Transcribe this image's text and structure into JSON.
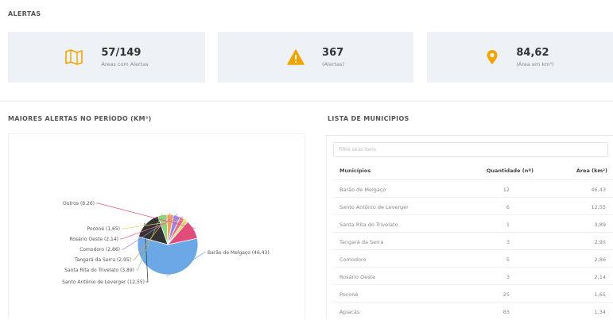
{
  "alertas": {
    "title": "ALERTAS",
    "cards": [
      {
        "icon": "map-icon",
        "value": "57/149",
        "label": "Áreas com Alertas"
      },
      {
        "icon": "warning-icon",
        "value": "367",
        "label": "(Alertas)"
      },
      {
        "icon": "location-pin-icon",
        "value": "84,62",
        "label": "(Área em km²)"
      }
    ]
  },
  "colors": {
    "accent": "#f0a500",
    "card_bg": "#eef2f6"
  },
  "chart_title": "MAIORES ALERTAS NO PERÍODO (KM²)",
  "list": {
    "title": "LISTA DE MUNICÍPIOS",
    "filter_placeholder": "Filtre seus itens",
    "headers": [
      "Municípios",
      "Quantidade (nº)",
      "Área (km²)"
    ],
    "rows": [
      [
        "Barão de Melgaço",
        "12",
        "46,43"
      ],
      [
        "Santo Antônio de Leverger",
        "6",
        "12,55"
      ],
      [
        "Santa Rita do Trivelato",
        "1",
        "3,89"
      ],
      [
        "Tangará da Serra",
        "3",
        "2,95"
      ],
      [
        "Comodoro",
        "5",
        "2,86"
      ],
      [
        "Rosário Oeste",
        "3",
        "2,14"
      ],
      [
        "Poconé",
        "25",
        "1,65"
      ],
      [
        "Apiacás",
        "83",
        "1,34"
      ]
    ]
  },
  "chart_data": {
    "type": "pie",
    "title": "MAIORES ALERTAS NO PERÍODO (KM²)",
    "slices": [
      {
        "label": "Barão de Melgaço",
        "value": 46.43,
        "display": "Barão de Melgaço (46,43)",
        "color": "#6ba8e5"
      },
      {
        "label": "Santo Antônio de Leverger",
        "value": 12.55,
        "display": "Santo Antônio de Leverger (12,55)",
        "color": "#333333"
      },
      {
        "label": "Santa Rita do Trivelato",
        "value": 3.89,
        "display": "Santa Rita do Trivelato (3,89)",
        "color": "#8fd17f"
      },
      {
        "label": "Tangará da Serra",
        "value": 2.95,
        "display": "Tangará da Serra (2,95)",
        "color": "#f4a15d"
      },
      {
        "label": "Comodoro",
        "value": 2.86,
        "display": "Comodoro (2,86)",
        "color": "#9b86e0"
      },
      {
        "label": "Rosário Oeste",
        "value": 2.14,
        "display": "Rosário Oeste (2,14)",
        "color": "#e86b8a"
      },
      {
        "label": "Poconé",
        "value": 1.65,
        "display": "Poconé (1,65)",
        "color": "#e8d66b"
      },
      {
        "label": "Outros",
        "value": 8.26,
        "display": "Outros (8,26)",
        "color": "#e14d7a"
      }
    ]
  }
}
